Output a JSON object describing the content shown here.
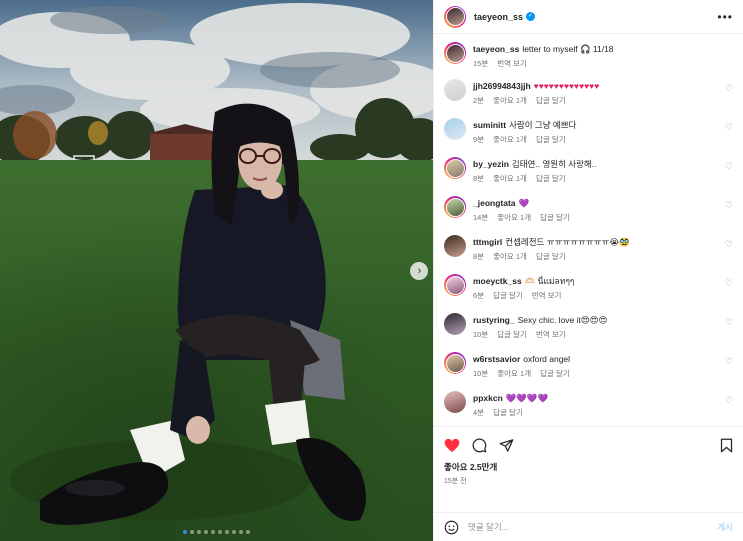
{
  "header": {
    "username": "taeyeon_ss",
    "more_label": "•••"
  },
  "caption": {
    "username": "taeyeon_ss",
    "text": "letter to myself 🎧 11/18",
    "time": "15분",
    "translate": "번역 보기"
  },
  "comments": [
    {
      "username": "jjh26994843jjh",
      "text": "♥♥♥♥♥♥♥♥♥♥♥♥♥",
      "time": "2분",
      "likes": "좋아요 1개",
      "reply": "답글 달기",
      "translate": ""
    },
    {
      "username": "suminitt",
      "text": "사람이 그냥 예쁘다",
      "time": "9분",
      "likes": "좋아요 1개",
      "reply": "답글 달기",
      "translate": ""
    },
    {
      "username": "by_yezin",
      "text": "김태연.. 영원히 사랑해..",
      "time": "8분",
      "likes": "좋아요 1개",
      "reply": "답글 달기",
      "translate": ""
    },
    {
      "username": "_jeongtata",
      "text": "💜",
      "time": "14분",
      "likes": "좋아요 1개",
      "reply": "답글 달기",
      "translate": ""
    },
    {
      "username": "tttmgirl",
      "text": "컨셉레전드 ㅠㅠㅠㅠㅠㅠㅠㅠ😭🥸",
      "time": "8분",
      "likes": "좋아요 1개",
      "reply": "답글 달기",
      "translate": ""
    },
    {
      "username": "moeyctk_ss",
      "text": "🫶🏻 นี่แม่ลทๆๆ",
      "time": "6분",
      "likes": "",
      "reply": "답글 달기",
      "translate": "번역 보기"
    },
    {
      "username": "rustyring_",
      "text": "Sexy chic. love it😍😍😍",
      "time": "10분",
      "likes": "",
      "reply": "답글 달기",
      "translate": "번역 보기"
    },
    {
      "username": "w6rstsavior",
      "text": "oxford angel",
      "time": "10분",
      "likes": "좋아요 1개",
      "reply": "답글 달기",
      "translate": ""
    },
    {
      "username": "ppxkcn",
      "text": "💜💜💜💜",
      "time": "4분",
      "likes": "",
      "reply": "답글 달기",
      "translate": ""
    }
  ],
  "actions": {
    "likes": "좋아요 2.5만개",
    "time": "15분 전",
    "icons": [
      "heart-filled-icon",
      "comment-icon",
      "share-icon",
      "bookmark-icon"
    ]
  },
  "add_comment": {
    "placeholder": "댓글 달기...",
    "post_label": "게시"
  },
  "carousel": {
    "slides": 10,
    "active": 0
  },
  "colors": {
    "accent": "#0095f6",
    "like": "#ff3040",
    "grass": "#2f5b25",
    "sky": "#9fb2bf"
  }
}
